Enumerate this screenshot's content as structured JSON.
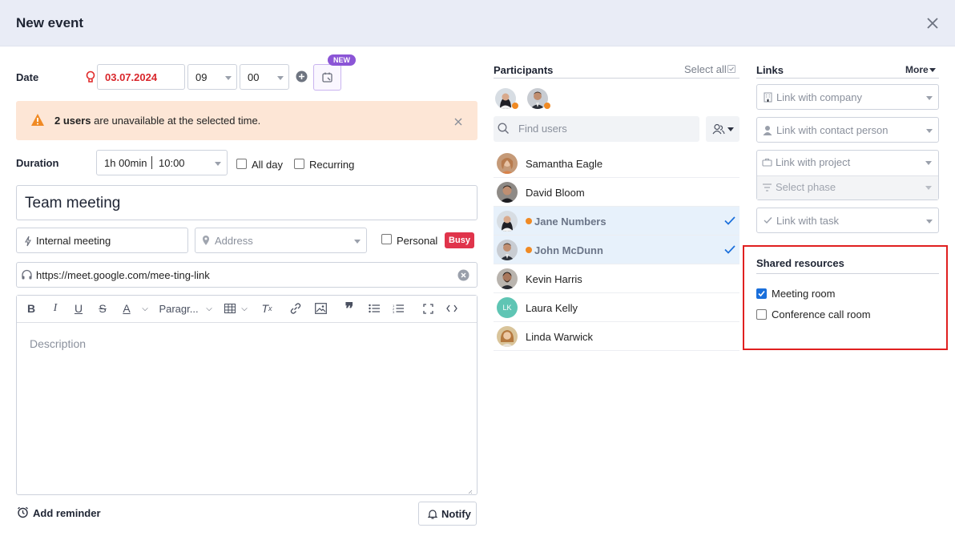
{
  "header": {
    "title": "New event"
  },
  "date": {
    "label": "Date",
    "value": "03.07.2024",
    "hour": "09",
    "minute": "00",
    "new_badge": "NEW"
  },
  "alert": {
    "bold": "2 users",
    "text": " are unavailable at the selected time."
  },
  "duration": {
    "label": "Duration",
    "value": "1h 00min",
    "end_time": "10:00",
    "all_day": "All day",
    "recurring": "Recurring"
  },
  "event_title": "Team meeting",
  "type": {
    "value": "Internal meeting",
    "address_placeholder": "Address",
    "personal": "Personal",
    "busy": "Busy"
  },
  "link_field": {
    "value": "https://meet.google.com/mee-ting-link"
  },
  "editor": {
    "paragraph": "Paragr...",
    "placeholder": "Description"
  },
  "footer": {
    "add_reminder": "Add reminder",
    "notify": "Notify"
  },
  "participants": {
    "title": "Participants",
    "select_all": "Select all",
    "search_placeholder": "Find users",
    "users": [
      {
        "name": "Samantha Eagle",
        "selected": false
      },
      {
        "name": "David Bloom",
        "selected": false
      },
      {
        "name": "Jane Numbers",
        "selected": true
      },
      {
        "name": "John McDunn",
        "selected": true
      },
      {
        "name": "Kevin Harris",
        "selected": false
      },
      {
        "name": "Laura Kelly",
        "initials": "LK",
        "selected": false
      },
      {
        "name": "Linda Warwick",
        "selected": false
      }
    ]
  },
  "links": {
    "title": "Links",
    "more": "More",
    "company": "Link with company",
    "contact": "Link with contact person",
    "project": "Link with project",
    "phase": "Select phase",
    "task": "Link with task"
  },
  "resources": {
    "title": "Shared resources",
    "items": [
      {
        "label": "Meeting room",
        "checked": true
      },
      {
        "label": "Conference call room",
        "checked": false
      }
    ]
  },
  "colors": {
    "accent": "#1a6fdb",
    "alert_bg": "#fde6d6",
    "badge_purple": "#8b55d6",
    "busy_red": "#e0344b",
    "highlight_red": "#e02020",
    "selected_row": "#e7f1fb"
  }
}
